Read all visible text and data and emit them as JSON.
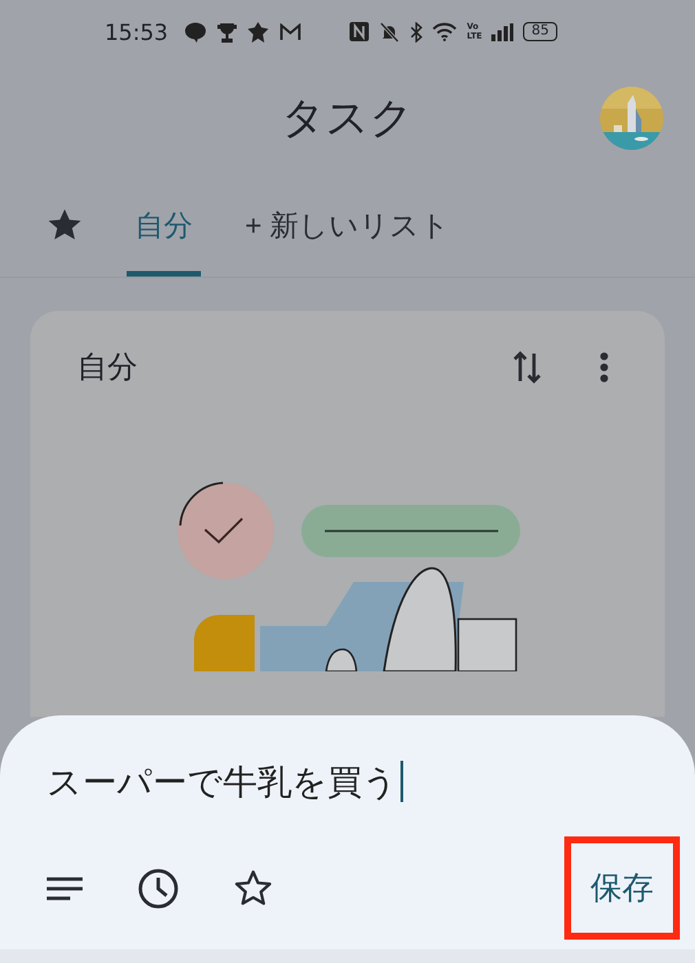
{
  "status_bar": {
    "time": "15:53",
    "network": [
      "Vo",
      "LTE"
    ],
    "battery": "85"
  },
  "header": {
    "title": "タスク"
  },
  "tabs": [
    {
      "kind": "icon",
      "selected": false
    },
    {
      "kind": "text",
      "label": "自分",
      "selected": true
    },
    {
      "kind": "text",
      "label": "+ 新しいリスト",
      "selected": false
    }
  ],
  "card": {
    "title": "自分"
  },
  "sheet": {
    "value": "スーパーで牛乳を買う",
    "save": "保存",
    "save_highlighted": true
  }
}
